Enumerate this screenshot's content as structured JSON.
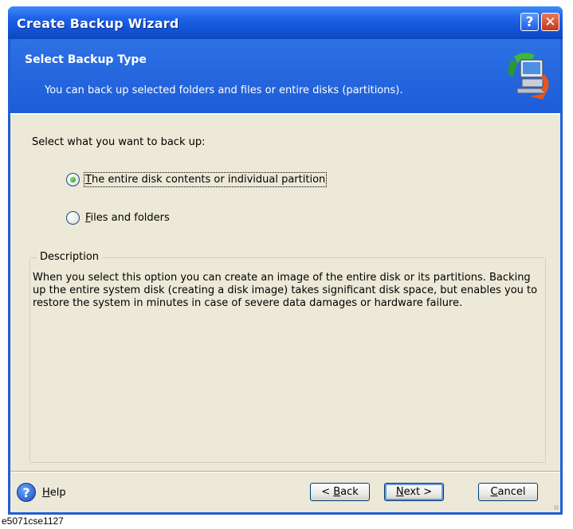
{
  "window": {
    "title": "Create Backup Wizard",
    "help_button": "?",
    "close_button": "✕"
  },
  "header": {
    "title": "Select Backup Type",
    "subtitle": "You can back up selected folders and files or entire disks (partitions)."
  },
  "body": {
    "prompt": "Select what you want to back up:",
    "options": [
      {
        "accel": "T",
        "rest": "he entire disk contents or individual partition",
        "selected": true
      },
      {
        "accel": "F",
        "rest": "iles and folders",
        "selected": false
      }
    ]
  },
  "description": {
    "legend": "Description",
    "text": "When you select this option you can create an image of the entire disk or its partitions. Backing up the entire system disk (creating a disk image) takes significant disk space, but enables you to restore the system in minutes in case of severe data damages or hardware failure."
  },
  "footer": {
    "help_icon_glyph": "?",
    "help": {
      "accel": "H",
      "rest": "elp"
    },
    "back": {
      "pre": "< ",
      "accel": "B",
      "rest": "ack"
    },
    "next": {
      "accel": "N",
      "rest": "ext >"
    },
    "cancel": {
      "accel": "C",
      "rest": "ancel"
    }
  },
  "caption": "e5071cse1127",
  "colors": {
    "titlebar": "#1f5fd6",
    "header": "#2667df",
    "client": "#ece9d8",
    "radio_dot": "#1e9a19"
  },
  "icons": {
    "header_icon": "computer-backup-icon",
    "help_icon": "help-icon"
  }
}
